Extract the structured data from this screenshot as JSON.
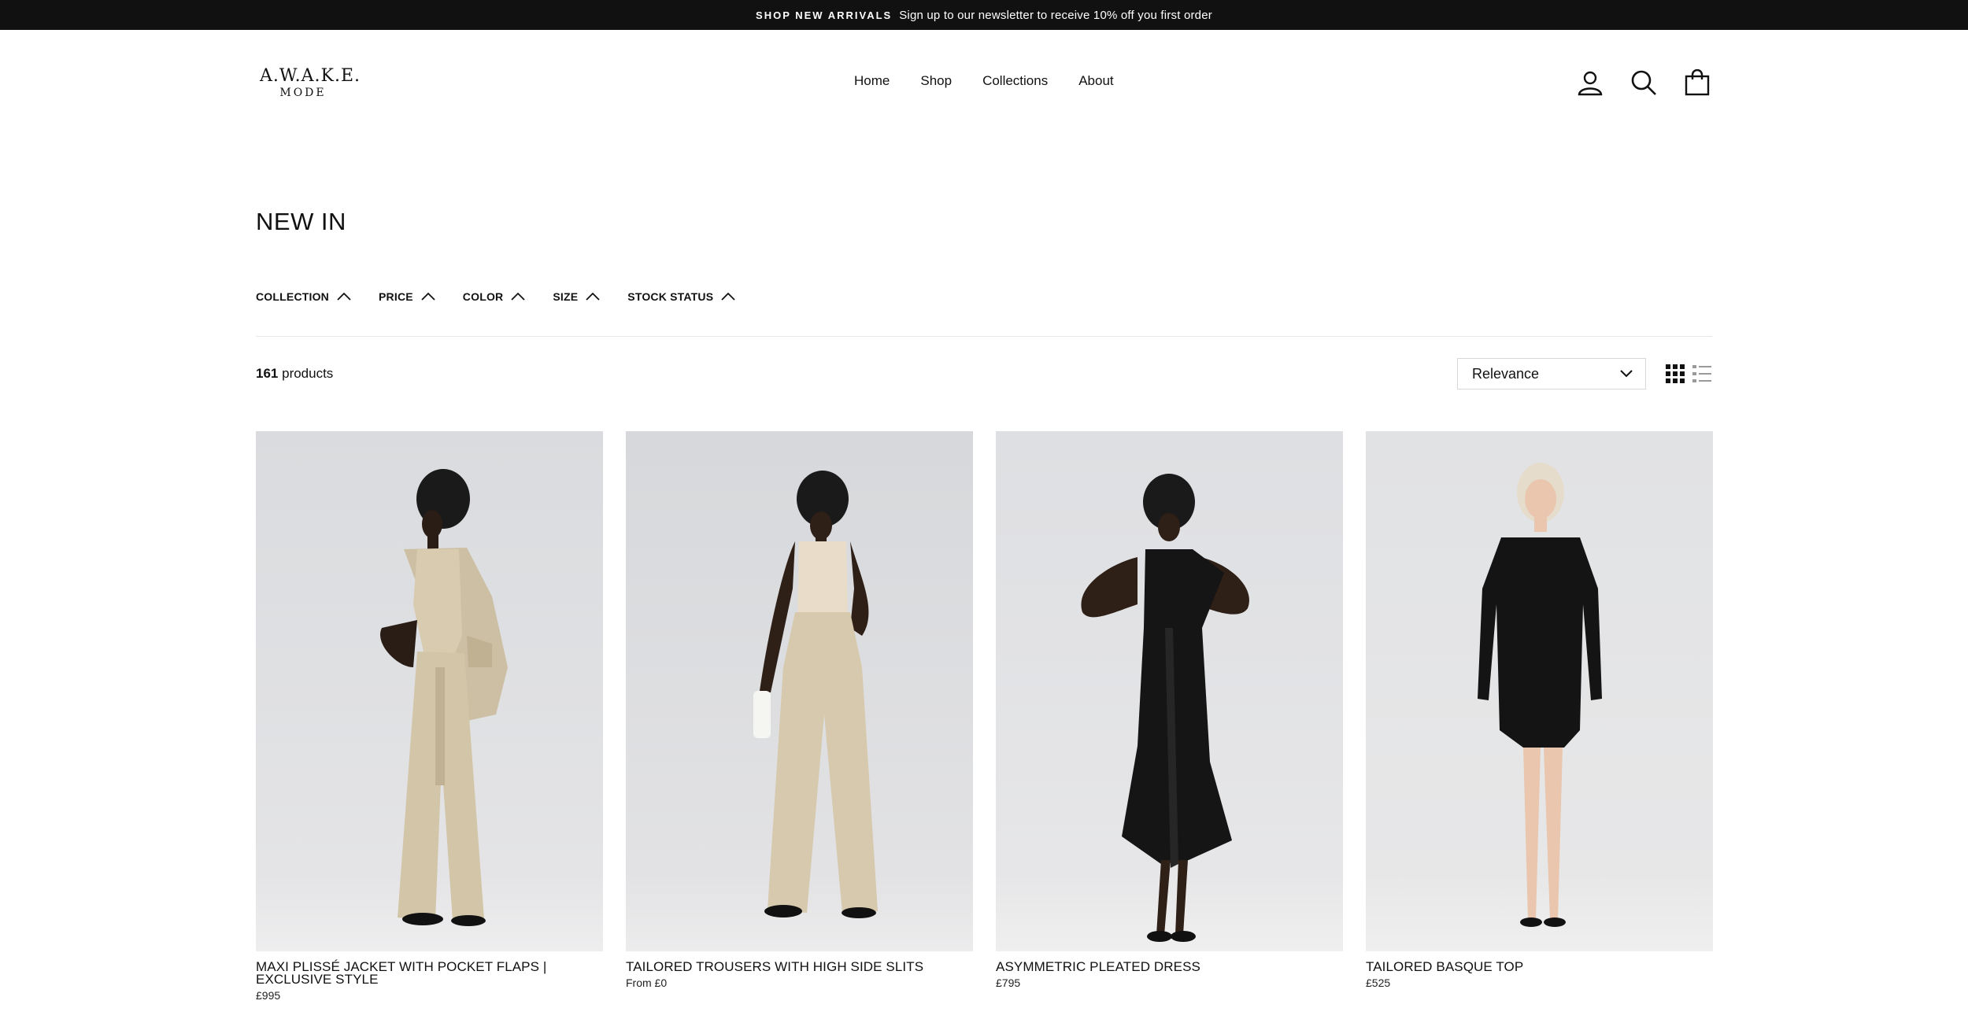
{
  "announcement": {
    "highlight": "SHOP NEW ARRIVALS",
    "text": "Sign up to our newsletter to receive 10% off you first order"
  },
  "logo": {
    "line1": "A.W.A.K.E.",
    "line2": "MODE"
  },
  "nav": {
    "items": [
      "Home",
      "Shop",
      "Collections",
      "About"
    ]
  },
  "header_icons": [
    "account-icon",
    "search-icon",
    "cart-icon"
  ],
  "page": {
    "title": "NEW IN"
  },
  "filters": [
    "COLLECTION",
    "PRICE",
    "COLOR",
    "SIZE",
    "STOCK STATUS"
  ],
  "results": {
    "count": "161",
    "label": "products"
  },
  "sort": {
    "selected": "Relevance"
  },
  "products": [
    {
      "name": "MAXI PLISSÉ JACKET WITH POCKET FLAPS | EXCLUSIVE STYLE",
      "price": "£995"
    },
    {
      "name": "TAILORED TROUSERS WITH HIGH SIDE SLITS",
      "price": "From £0"
    },
    {
      "name": "ASYMMETRIC PLEATED DRESS",
      "price": "£795"
    },
    {
      "name": "TAILORED BASQUE TOP",
      "price": "£525"
    }
  ],
  "colors": {
    "announcement_bg": "#111111",
    "text": "#111111",
    "divider": "#e6e6e6"
  }
}
